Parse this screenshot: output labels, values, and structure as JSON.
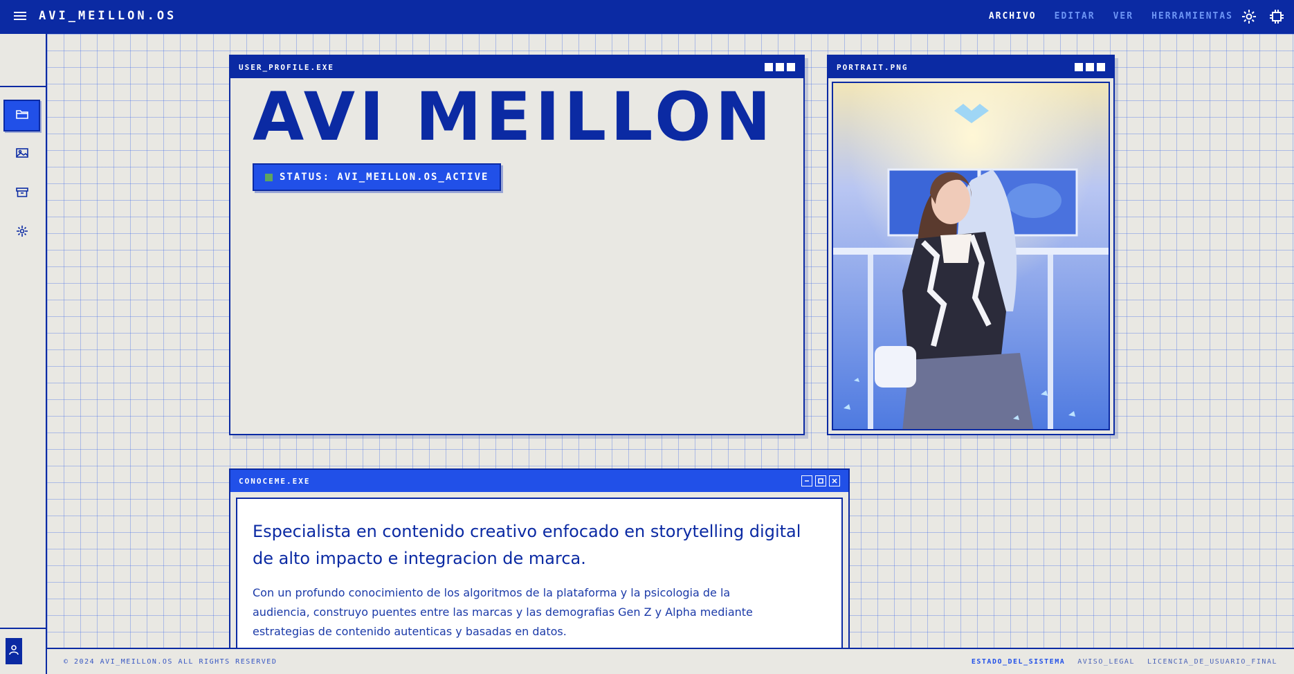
{
  "app": {
    "brand": "AVI_MEILLON.OS"
  },
  "topnav": {
    "items": [
      {
        "label": "ARCHIVO"
      },
      {
        "label": "EDITAR"
      },
      {
        "label": "VER"
      },
      {
        "label": "HERRAMIENTAS"
      }
    ],
    "icons": [
      "sun-icon",
      "chip-icon"
    ]
  },
  "sidebar": {
    "items": [
      {
        "icon": "folder-icon",
        "active": true
      },
      {
        "icon": "image-icon",
        "active": false
      },
      {
        "icon": "archive-icon",
        "active": false
      },
      {
        "icon": "sparkle-icon",
        "active": false
      }
    ],
    "bottom_icon": "user-icon"
  },
  "profile_window": {
    "title": "USER_PROFILE.EXE",
    "name": "AVI MEILLON",
    "status": "STATUS: AVI_MEILLON.OS_ACTIVE"
  },
  "portrait_window": {
    "title": "PORTRAIT.PNG"
  },
  "about_window": {
    "title": "CONOCEME.EXE",
    "lead": "Especialista en contenido creativo enfocado en storytelling digital de alto impacto e integracion de marca.",
    "text": "Con un profundo conocimiento de los algoritmos de la plataforma y la psicologia de la audiencia, construyo puentes entre las marcas y las demografias Gen Z y Alpha mediante estrategias de contenido autenticas y basadas en datos."
  },
  "footer": {
    "copyright": "© 2024 AVI_MEILLON.OS ALL RIGHTS RESERVED",
    "links": [
      {
        "label": "ESTADO_DEL_SISTEMA"
      },
      {
        "label": "AVISO_LEGAL"
      },
      {
        "label": "LICENCIA_DE_USUARIO_FINAL"
      }
    ]
  },
  "colors": {
    "primary": "#0b2aa3",
    "accent": "#2150e8",
    "background": "#e9e8e3",
    "status_dot": "#5ea45f"
  }
}
